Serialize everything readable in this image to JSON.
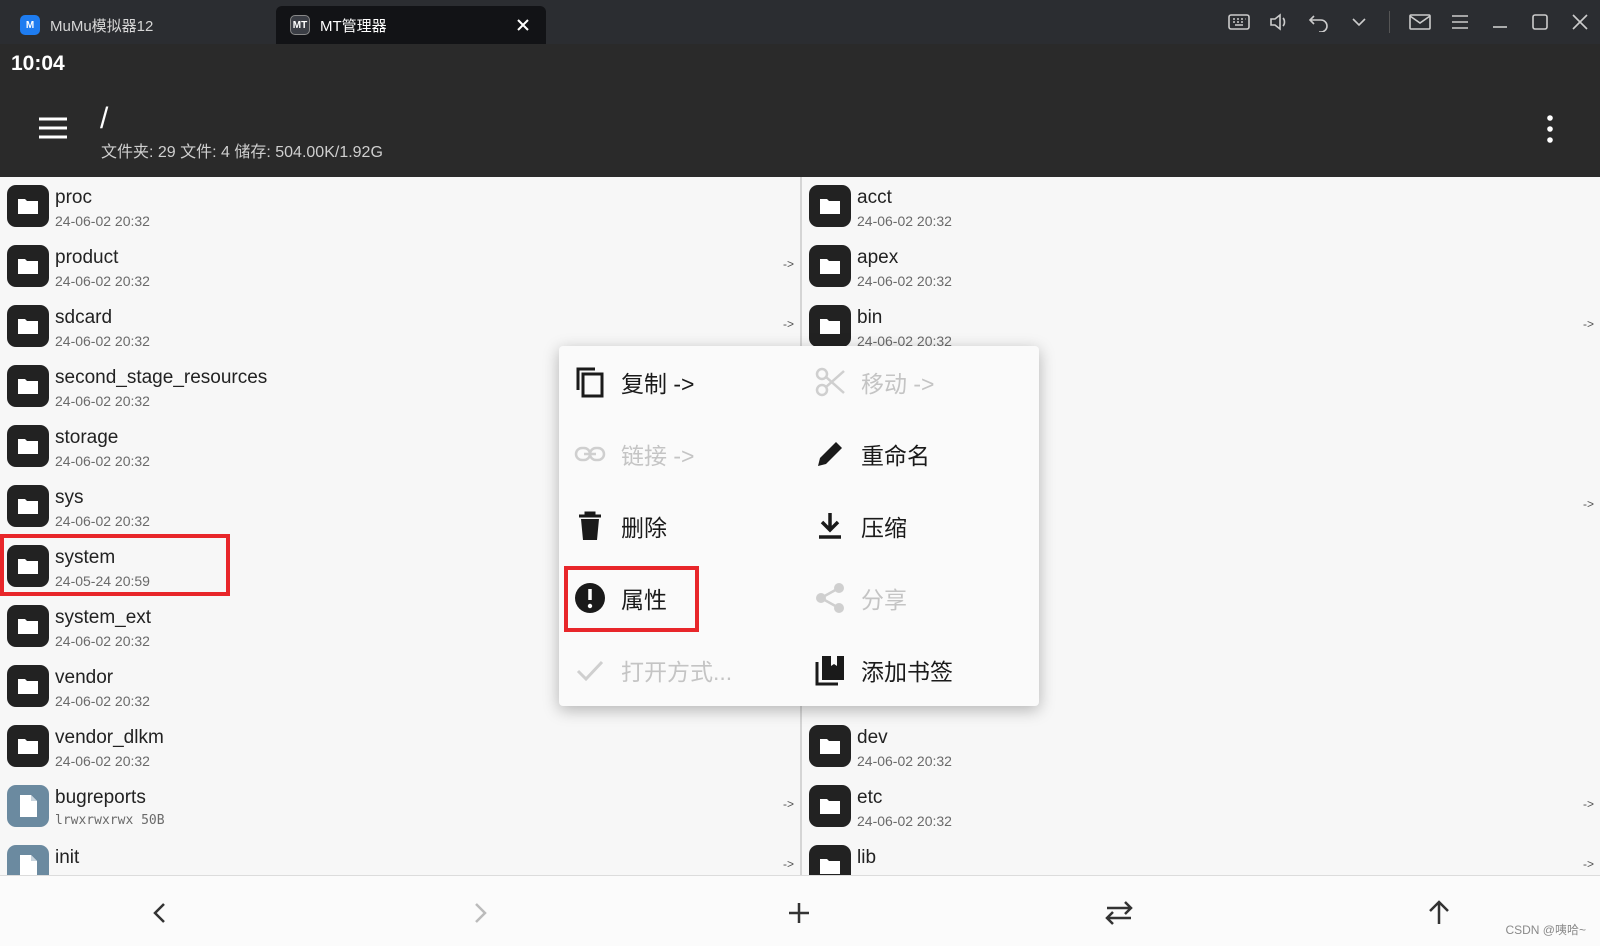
{
  "window": {
    "tabs": [
      {
        "label": "MuMu模拟器12",
        "icon": "mumu-logo-icon"
      },
      {
        "label": "MT管理器",
        "icon": "mt-logo-icon"
      }
    ]
  },
  "status": {
    "time": "10:04"
  },
  "header": {
    "path": "/",
    "info": "文件夹: 29  文件: 4  储存: 504.00K/1.92G"
  },
  "left_pane": {
    "items": [
      {
        "name": "proc",
        "meta": "24-06-02 20:32",
        "type": "folder",
        "link": ""
      },
      {
        "name": "product",
        "meta": "24-06-02 20:32",
        "type": "folder",
        "link": "->"
      },
      {
        "name": "sdcard",
        "meta": "24-06-02 20:32",
        "type": "folder",
        "link": "->"
      },
      {
        "name": "second_stage_resources",
        "meta": "24-06-02 20:32",
        "type": "folder",
        "link": ""
      },
      {
        "name": "storage",
        "meta": "24-06-02 20:32",
        "type": "folder",
        "link": ""
      },
      {
        "name": "sys",
        "meta": "24-06-02 20:32",
        "type": "folder",
        "link": ""
      },
      {
        "name": "system",
        "meta": "24-05-24 20:59",
        "type": "folder",
        "link": ""
      },
      {
        "name": "system_ext",
        "meta": "24-06-02 20:32",
        "type": "folder",
        "link": ""
      },
      {
        "name": "vendor",
        "meta": "24-06-02 20:32",
        "type": "folder",
        "link": ""
      },
      {
        "name": "vendor_dlkm",
        "meta": "24-06-02 20:32",
        "type": "folder",
        "link": ""
      },
      {
        "name": "bugreports",
        "meta": "lrwxrwxrwx 50B",
        "type": "file",
        "link": "->"
      },
      {
        "name": "init",
        "meta": "",
        "type": "file",
        "link": "->"
      }
    ]
  },
  "right_pane": {
    "items": [
      {
        "name": "acct",
        "meta": "24-06-02 20:32",
        "type": "folder",
        "link": ""
      },
      {
        "name": "apex",
        "meta": "24-06-02 20:32",
        "type": "folder",
        "link": ""
      },
      {
        "name": "bin",
        "meta": "24-06-02 20:32",
        "type": "folder",
        "link": "->"
      },
      {
        "name": "",
        "meta": "",
        "type": "hidden",
        "link": ""
      },
      {
        "name": "",
        "meta": "",
        "type": "hidden",
        "link": ""
      },
      {
        "name": "",
        "meta": "",
        "type": "hidden",
        "link": "->"
      },
      {
        "name": "",
        "meta": "",
        "type": "hidden",
        "link": ""
      },
      {
        "name": "",
        "meta": "",
        "type": "hidden",
        "link": ""
      },
      {
        "name": "",
        "meta": "",
        "type": "hidden",
        "link": ""
      },
      {
        "name": "dev",
        "meta": "24-06-02 20:32",
        "type": "folder",
        "link": ""
      },
      {
        "name": "etc",
        "meta": "24-06-02 20:32",
        "type": "folder",
        "link": "->"
      },
      {
        "name": "lib",
        "meta": "",
        "type": "folder",
        "link": "->"
      }
    ]
  },
  "context_menu": {
    "copy": "复制 ->",
    "move": "移动 ->",
    "link": "链接 ->",
    "rename": "重命名",
    "delete": "删除",
    "compress": "压缩",
    "properties": "属性",
    "share": "分享",
    "open_with": "打开方式...",
    "bookmark": "添加书签"
  },
  "watermark": "CSDN @咦哈~",
  "colors": {
    "highlight": "#e8262a",
    "header_bg": "#2a2a2a",
    "titlebar_bg": "#2b2d31"
  }
}
